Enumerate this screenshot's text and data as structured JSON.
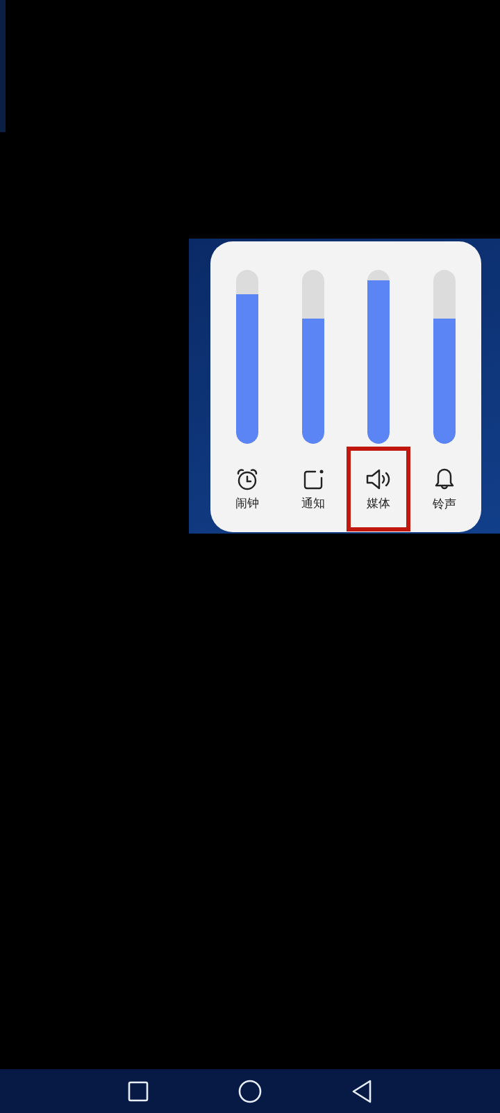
{
  "volume_panel": {
    "channels": [
      {
        "label": "闹钟",
        "kind": "alarm",
        "level": 0.86,
        "selected": false
      },
      {
        "label": "通知",
        "kind": "notification",
        "level": 0.72,
        "selected": false
      },
      {
        "label": "媒体",
        "kind": "media",
        "level": 0.94,
        "selected": true
      },
      {
        "label": "铃声",
        "kind": "ringtone",
        "level": 0.72,
        "selected": false
      }
    ]
  },
  "nav_bar": {
    "buttons": [
      {
        "kind": "recents"
      },
      {
        "kind": "home"
      },
      {
        "kind": "back"
      }
    ]
  }
}
